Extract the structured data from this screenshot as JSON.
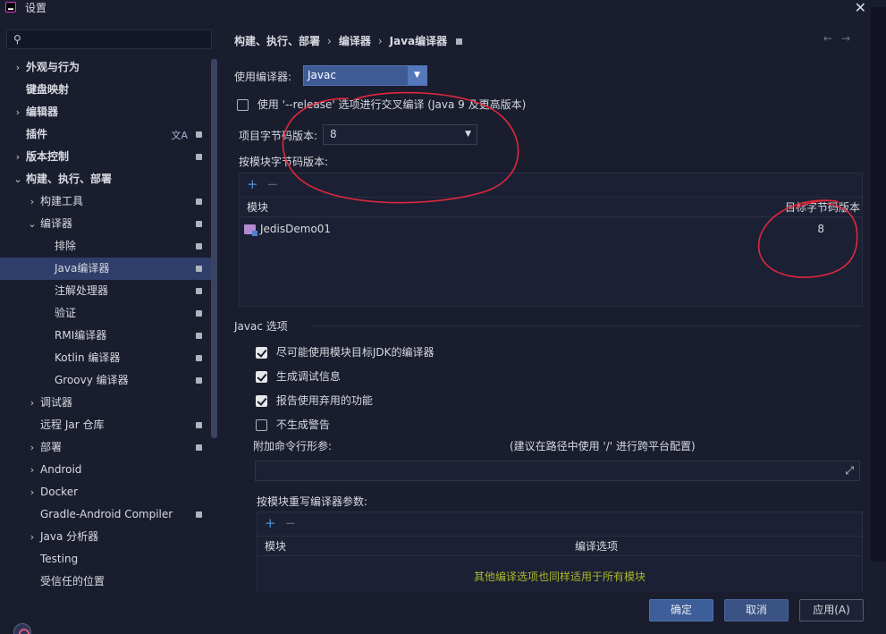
{
  "window": {
    "title": "设置"
  },
  "search": {
    "value": "",
    "placeholder": ""
  },
  "sidebar": {
    "items": [
      {
        "label": "外观与行为",
        "level": 0,
        "arrow": "›",
        "bold": true
      },
      {
        "label": "键盘映射",
        "level": 0,
        "arrow": "",
        "bold": true
      },
      {
        "label": "编辑器",
        "level": 0,
        "arrow": "›",
        "bold": true
      },
      {
        "label": "插件",
        "level": 0,
        "arrow": "",
        "bold": true,
        "pinned": true,
        "translate": true
      },
      {
        "label": "版本控制",
        "level": 0,
        "arrow": "›",
        "bold": true,
        "pinned": true
      },
      {
        "label": "构建、执行、部署",
        "level": 0,
        "arrow": "⌄",
        "bold": true
      },
      {
        "label": "构建工具",
        "level": 1,
        "arrow": "›",
        "pinned": true
      },
      {
        "label": "编译器",
        "level": 1,
        "arrow": "⌄",
        "pinned": true
      },
      {
        "label": "排除",
        "level": 2,
        "arrow": "",
        "pinned": true
      },
      {
        "label": "Java编译器",
        "level": 2,
        "arrow": "",
        "pinned": true,
        "selected": true
      },
      {
        "label": "注解处理器",
        "level": 2,
        "arrow": "",
        "pinned": true
      },
      {
        "label": "验证",
        "level": 2,
        "arrow": "",
        "pinned": true
      },
      {
        "label": "RMI编译器",
        "level": 2,
        "arrow": "",
        "pinned": true
      },
      {
        "label": "Kotlin 编译器",
        "level": 2,
        "arrow": "",
        "pinned": true
      },
      {
        "label": "Groovy 编译器",
        "level": 2,
        "arrow": "",
        "pinned": true
      },
      {
        "label": "调试器",
        "level": 1,
        "arrow": "›"
      },
      {
        "label": "远程 Jar 仓库",
        "level": 1,
        "arrow": "",
        "pinned": true
      },
      {
        "label": "部署",
        "level": 1,
        "arrow": "›",
        "pinned": true
      },
      {
        "label": "Android",
        "level": 1,
        "arrow": "›"
      },
      {
        "label": "Docker",
        "level": 1,
        "arrow": "›"
      },
      {
        "label": "Gradle-Android Compiler",
        "level": 1,
        "arrow": "",
        "pinned": true
      },
      {
        "label": "Java 分析器",
        "level": 1,
        "arrow": "›"
      },
      {
        "label": "Testing",
        "level": 1,
        "arrow": ""
      },
      {
        "label": "受信任的位置",
        "level": 1,
        "arrow": ""
      }
    ]
  },
  "breadcrumb": {
    "part1": "构建、执行、部署",
    "sep": "›",
    "part2": "编译器",
    "part3": "Java编译器"
  },
  "nav": {
    "back": "←",
    "forward": "→"
  },
  "compiler": {
    "label": "使用编译器:",
    "value": "Javac"
  },
  "release_option": {
    "label": "使用 '--release' 选项进行交叉编译 (Java 9 及更高版本)",
    "checked": false
  },
  "bytecode": {
    "label": "项目字节码版本:",
    "value": "8"
  },
  "per_module": {
    "label": "按模块字节码版本:",
    "add": "+",
    "remove": "−",
    "col_module": "模块",
    "col_target": "目标字节码版本",
    "rows": [
      {
        "module": "JedisDemo01",
        "target": "8"
      }
    ]
  },
  "javac_section": {
    "title": "Javac 选项"
  },
  "javac_options": [
    {
      "label": "尽可能使用模块目标JDK的编译器",
      "checked": true
    },
    {
      "label": "生成调试信息",
      "checked": true
    },
    {
      "label": "报告使用弃用的功能",
      "checked": true
    },
    {
      "label": "不生成警告",
      "checked": false
    }
  ],
  "extra_args": {
    "label": "附加命令行形参:",
    "hint": "(建议在路径中使用 '/' 进行跨平台配置)",
    "value": ""
  },
  "override": {
    "label": "按模块重写编译器参数:",
    "add": "+",
    "remove": "−",
    "col_module": "模块",
    "col_options": "编译选项",
    "empty_hint": "其他编译选项也同样适用于所有模块"
  },
  "buttons": {
    "ok": "确定",
    "cancel": "取消",
    "apply": "应用(A)"
  },
  "colors": {
    "accent": "#3d5e98",
    "selection": "#2f3e6a",
    "hint": "#a8b82a",
    "annotation": "#e0283c"
  }
}
